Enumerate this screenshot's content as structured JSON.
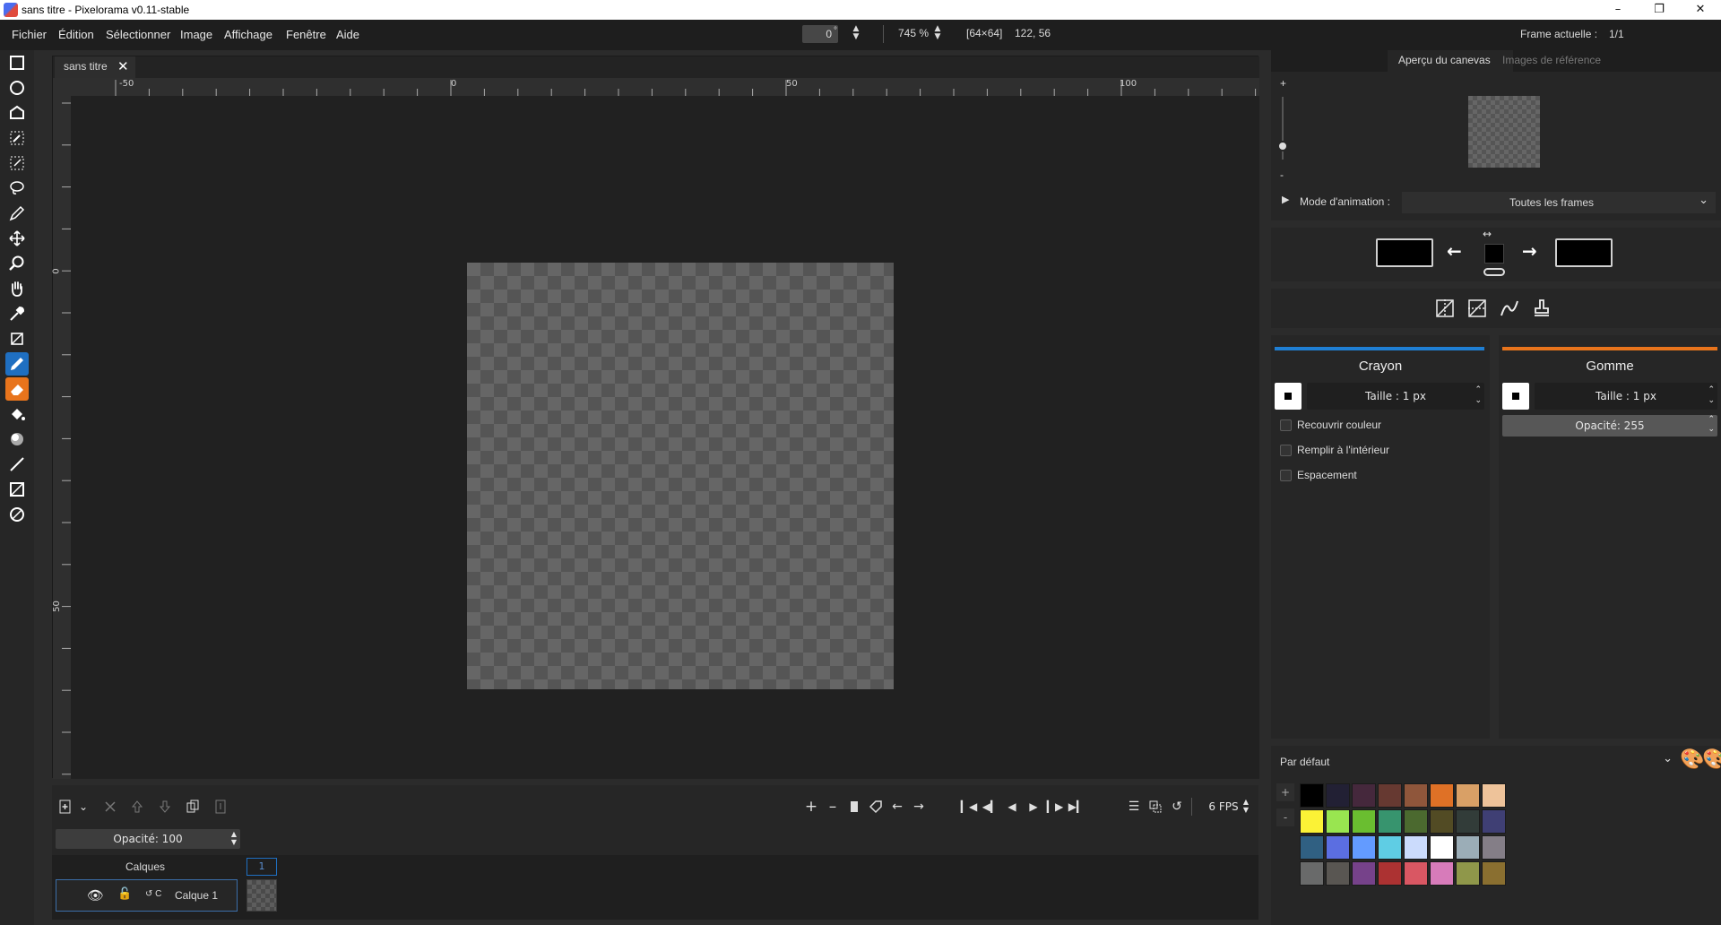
{
  "window": {
    "title": "sans titre - Pixelorama v0.11-stable"
  },
  "menu": [
    "Fichier",
    "Édition",
    "Sélectionner",
    "Image",
    "Affichage",
    "Fenêtre",
    "Aide"
  ],
  "topbar": {
    "rotation_value": "0",
    "rotation_unit": "°",
    "zoom_value": "745 %",
    "canvas_size": "[64×64]",
    "cursor_position": "122, 56",
    "current_frame_label": "Frame actuelle :",
    "current_frame_value": "1/1"
  },
  "tools": [
    "rectangle-select-icon",
    "ellipse-select-icon",
    "polygon-select-icon",
    "color-select-icon",
    "magic-wand-icon",
    "lasso-icon",
    "pen-select-icon",
    "move-icon",
    "zoom-icon",
    "pan-icon",
    "color-picker-icon",
    "crop-icon",
    "pencil-icon",
    "eraser-icon",
    "bucket-icon",
    "shading-icon",
    "line-icon",
    "rectangle-icon",
    "ellipse-icon"
  ],
  "canvas_tab": {
    "label": "sans titre"
  },
  "rulers": {
    "h_labels": [
      "-50",
      "0",
      "50",
      "100"
    ],
    "v_labels": [
      "0",
      "50"
    ]
  },
  "right_tabs": [
    "Aperçu du canevas",
    "Images de référence"
  ],
  "preview": {
    "zoom_plus": "+",
    "zoom_minus": "-",
    "animation_mode_label": "Mode d'animation :",
    "animation_mode_value": "Toutes les frames"
  },
  "tool_left": {
    "name": "Crayon",
    "accent": "#1f7fd4",
    "size": "Taille : 1 px",
    "options": [
      "Recouvrir couleur",
      "Remplir à l'intérieur",
      "Espacement"
    ]
  },
  "tool_right": {
    "name": "Gomme",
    "accent": "#e8741c",
    "size": "Taille : 1 px",
    "opacity": "Opacité: 255"
  },
  "palette": {
    "name": "Par défaut",
    "add": "+",
    "remove": "-",
    "colors": [
      "#000000",
      "#222034",
      "#45283c",
      "#663931",
      "#8f563b",
      "#df7126",
      "#d9a066",
      "#eec39a",
      "#fbf236",
      "#99e550",
      "#6abe30",
      "#37946e",
      "#4b692f",
      "#524b24",
      "#323c39",
      "#3f3f74",
      "#306082",
      "#5b6ee1",
      "#639bff",
      "#5fcde4",
      "#cbdbfc",
      "#ffffff",
      "#9badb7",
      "#847e87",
      "#696a6a",
      "#595652",
      "#76428a",
      "#ac3232",
      "#d95763",
      "#d77bba",
      "#8f974a",
      "#8a6f30"
    ]
  },
  "timeline": {
    "opacity": "Opacité: 100",
    "fps": "6 FPS",
    "layers_label": "Calques",
    "frame_number": "1",
    "layer_name": "Calque 1",
    "layer_link_text": "↺ C"
  }
}
